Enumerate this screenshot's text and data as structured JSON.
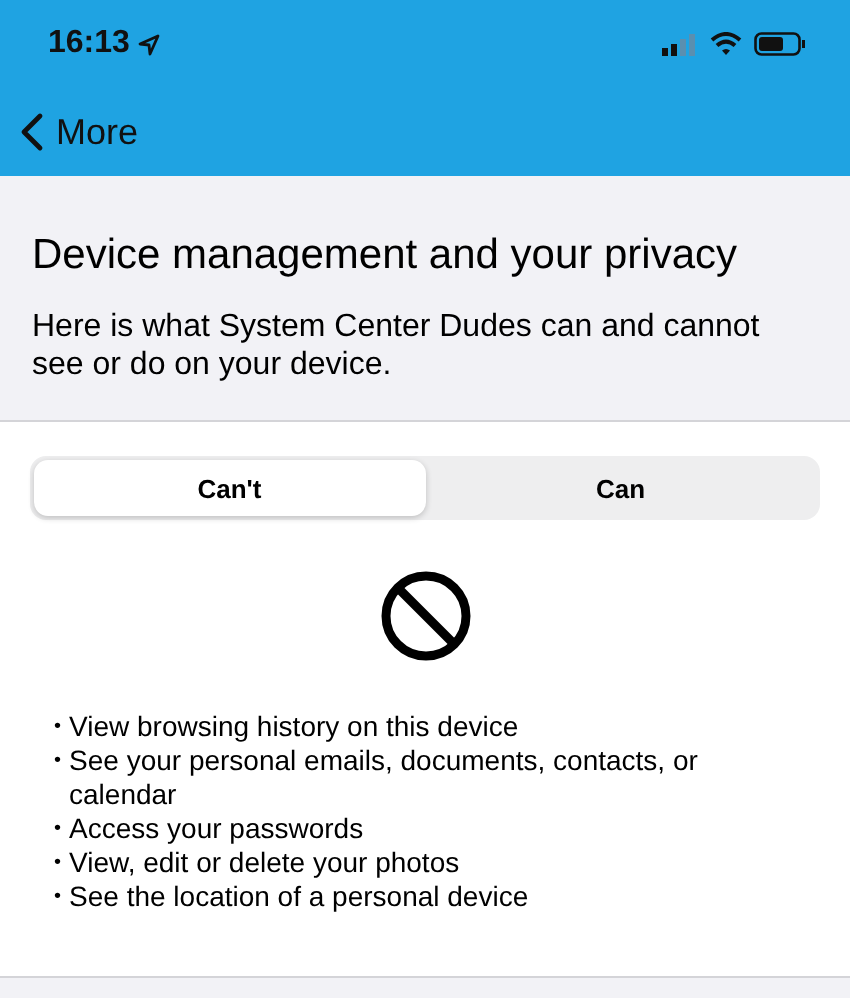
{
  "status_bar": {
    "time": "16:13"
  },
  "nav": {
    "back_label": "More"
  },
  "header": {
    "title": "Device management and your privacy",
    "description": "Here is what System Center Dudes can and cannot see or do on your device."
  },
  "segments": [
    {
      "label": "Can't",
      "selected": true
    },
    {
      "label": "Can",
      "selected": false
    }
  ],
  "list": {
    "bullet": "•",
    "items": [
      "View browsing history on this device",
      "See your personal emails, documents, contacts, or calendar",
      "Access your passwords",
      "View, edit or delete your photos",
      "See the location of a personal device"
    ]
  }
}
